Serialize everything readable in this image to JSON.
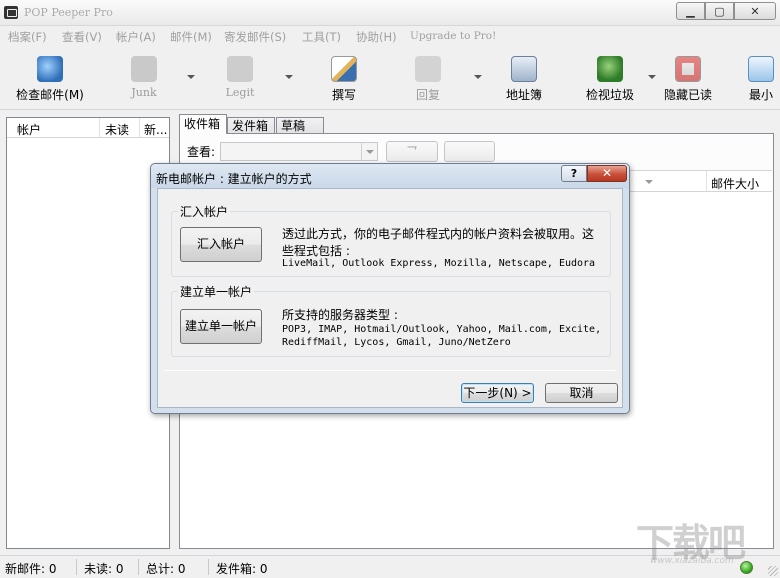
{
  "window": {
    "title": "POP Peeper Pro",
    "controls": {
      "minimize": "▁",
      "maximize": "▢",
      "close": "✕"
    }
  },
  "menu": [
    {
      "label": "档案(F)"
    },
    {
      "label": "查看(V)"
    },
    {
      "label": "帐户(A)"
    },
    {
      "label": "邮件(M)"
    },
    {
      "label": "寄发邮件(S)"
    },
    {
      "label": "工具(T)"
    },
    {
      "label": "协助(H)"
    },
    {
      "label": "Upgrade to Pro!"
    }
  ],
  "toolbar": [
    {
      "label": "检查邮件(M)",
      "icon": "check-mail-icon",
      "enabled": true
    },
    {
      "label": "Junk",
      "icon": "junk-thumb-down-icon",
      "enabled": false
    },
    {
      "label": "Legit",
      "icon": "legit-thumb-up-icon",
      "enabled": false
    },
    {
      "label": "撰写",
      "icon": "compose-icon",
      "enabled": true
    },
    {
      "label": "回复",
      "icon": "reply-icon",
      "enabled": false
    },
    {
      "label": "地址簿",
      "icon": "address-book-icon",
      "enabled": true
    },
    {
      "label": "检视垃圾",
      "icon": "view-junk-icon",
      "enabled": true
    },
    {
      "label": "隐藏已读",
      "icon": "hide-read-icon",
      "enabled": true
    },
    {
      "label": "最小",
      "icon": "minimize-icon",
      "enabled": true
    }
  ],
  "accounts_panel": {
    "columns": [
      "帐户",
      "未读",
      "新..."
    ]
  },
  "tabs": [
    "收件箱",
    "发件箱",
    "草稿"
  ],
  "view": {
    "label": "查看:",
    "value": ""
  },
  "mail_list": {
    "size_column": "邮件大小"
  },
  "dialog": {
    "title": "新电邮帐户 : 建立帐户的方式",
    "help": "?",
    "close": "✕",
    "import_group": {
      "title": "汇入帐户",
      "button": "汇入帐户",
      "desc_line1": "透过此方式，你的电子邮件程式内的帐户资料会被取用。这",
      "desc_line2": "些程式包括 :",
      "programs": "LiveMail, Outlook Express, Mozilla, Netscape, Eudora"
    },
    "single_group": {
      "title": "建立单一帐户",
      "button": "建立单一帐户",
      "desc": "所支持的服务器类型 :",
      "servers_line1": "POP3, IMAP, Hotmail/Outlook, Yahoo, Mail.com, Excite,",
      "servers_line2": "RediffMail, Lycos, Gmail, Juno/NetZero"
    },
    "next_button": "下一步(N) >",
    "cancel_button": "取消"
  },
  "statusbar": {
    "new_mail": "新邮件: 0",
    "unread": "未读: 0",
    "total": "总计: 0",
    "outbox": "发件箱: 0"
  },
  "watermark": {
    "text": "下载吧",
    "url": "www.xiazaiba.com"
  }
}
